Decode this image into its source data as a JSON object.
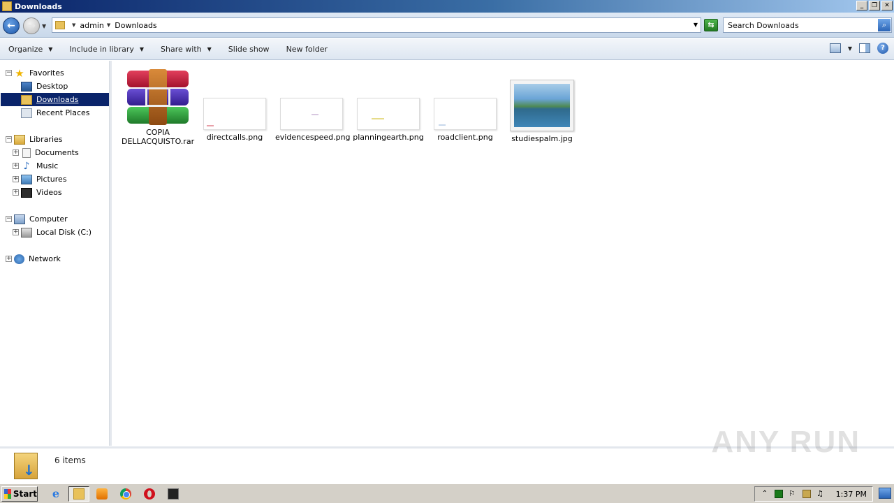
{
  "window": {
    "title": "Downloads"
  },
  "window_controls": {
    "minimize": "_",
    "restore": "❐",
    "close": "✕"
  },
  "address": {
    "crumbs": [
      "admin",
      "Downloads"
    ],
    "search_placeholder": "Search Downloads"
  },
  "toolbar": {
    "organize": "Organize",
    "include_in_library": "Include in library",
    "share_with": "Share with",
    "slide_show": "Slide show",
    "new_folder": "New folder"
  },
  "nav": {
    "favorites": "Favorites",
    "desktop": "Desktop",
    "downloads": "Downloads",
    "recent_places": "Recent Places",
    "libraries": "Libraries",
    "documents": "Documents",
    "music": "Music",
    "pictures": "Pictures",
    "videos": "Videos",
    "computer": "Computer",
    "local_disk": "Local Disk (C:)",
    "network": "Network"
  },
  "files": [
    {
      "name_line1": "COPIA",
      "name_line2": "DELLACQUISTO.rar",
      "type": "rar"
    },
    {
      "name": "directcalls.png",
      "type": "png",
      "mark_color": "#e8a0a8"
    },
    {
      "name": "evidencespeed.png",
      "type": "png",
      "mark_color": "#d8c8e0"
    },
    {
      "name": "planningearth.png",
      "type": "png",
      "mark_color": "#e6dc8a"
    },
    {
      "name": "roadclient.png",
      "type": "png",
      "mark_color": "#c8d8ec"
    },
    {
      "name": "studiespalm.jpg",
      "type": "jpg"
    }
  ],
  "details": {
    "count": "6 items",
    "watermark": "ANY RUN"
  },
  "taskbar": {
    "start": "Start",
    "clock": "1:37 PM"
  },
  "colors": {
    "selection": "#0a246a",
    "titlebar": "#0a246a"
  }
}
